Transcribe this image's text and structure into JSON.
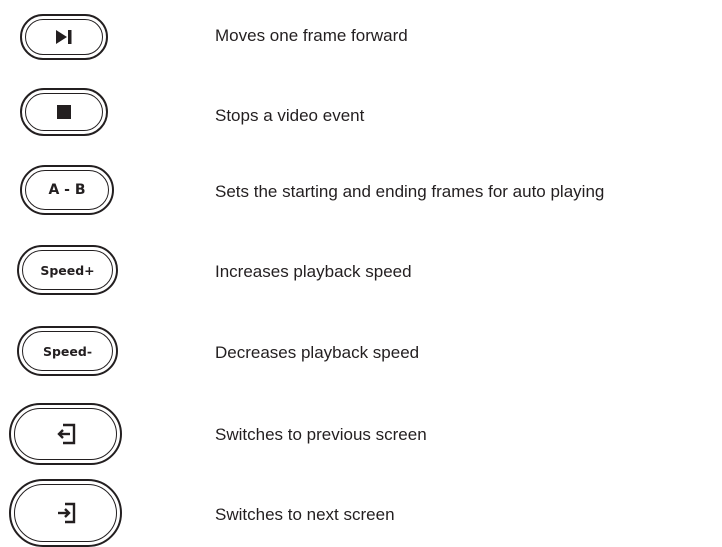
{
  "rows": [
    {
      "icon": "step-forward-icon",
      "description": "Moves one frame forward"
    },
    {
      "icon": "stop-icon",
      "description": "Stops a video event"
    },
    {
      "label": "A - B",
      "description": "Sets the starting and ending frames for auto playing"
    },
    {
      "label": "Speed+",
      "description": "Increases playback speed"
    },
    {
      "label": "Speed-",
      "description": "Decreases playback speed"
    },
    {
      "icon": "previous-screen-icon",
      "description": "Switches to previous screen"
    },
    {
      "icon": "next-screen-icon",
      "description": "Switches to next screen"
    }
  ],
  "colors": {
    "ink": "#231f20",
    "background": "#ffffff"
  }
}
